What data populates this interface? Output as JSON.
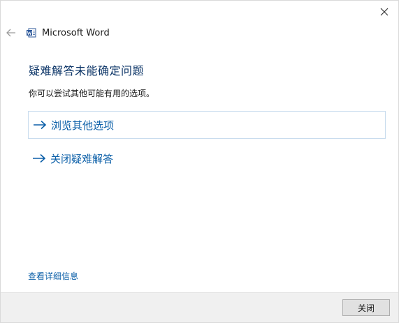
{
  "window": {
    "close_glyph": "✕"
  },
  "header": {
    "app_title": "Microsoft Word",
    "app_icon": "word-icon",
    "back_icon": "back-arrow-icon"
  },
  "main": {
    "heading": "疑难解答未能确定问题",
    "subtext": "你可以尝试其他可能有用的选项。",
    "options": [
      {
        "label": "浏览其他选项",
        "icon": "arrow-right-icon",
        "selected": true
      },
      {
        "label": "关闭疑难解答",
        "icon": "arrow-right-icon",
        "selected": false
      }
    ],
    "details_link": "查看详细信息"
  },
  "footer": {
    "close_label": "关闭"
  },
  "colors": {
    "heading": "#0a3366",
    "link": "#0b5fa8",
    "footer_bg": "#f0f0f0"
  }
}
